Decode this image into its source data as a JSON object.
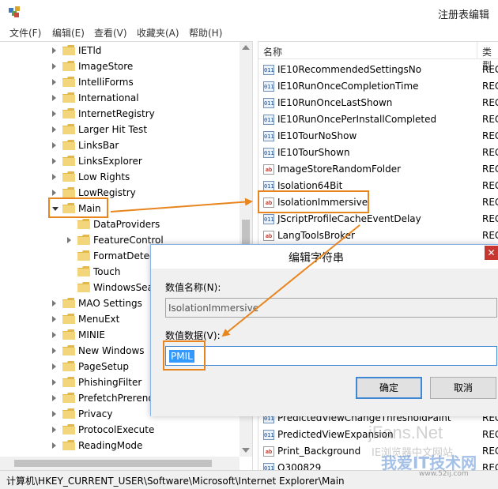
{
  "window": {
    "title": "注册表编辑"
  },
  "menu": [
    "文件(F)",
    "编辑(E)",
    "查看(V)",
    "收藏夹(A)",
    "帮助(H)"
  ],
  "tree": {
    "items": [
      {
        "label": "IETld",
        "level": 1,
        "expanded": false
      },
      {
        "label": "ImageStore",
        "level": 1,
        "expanded": false
      },
      {
        "label": "IntelliForms",
        "level": 1,
        "expanded": false
      },
      {
        "label": "International",
        "level": 1,
        "expanded": false
      },
      {
        "label": "InternetRegistry",
        "level": 1,
        "expanded": false
      },
      {
        "label": "Larger Hit Test",
        "level": 1,
        "expanded": false
      },
      {
        "label": "LinksBar",
        "level": 1,
        "expanded": false
      },
      {
        "label": "LinksExplorer",
        "level": 1,
        "expanded": false
      },
      {
        "label": "Low Rights",
        "level": 1,
        "expanded": false
      },
      {
        "label": "LowRegistry",
        "level": 1,
        "expanded": false
      },
      {
        "label": "Main",
        "level": 1,
        "expanded": true
      },
      {
        "label": "DataProviders",
        "level": 2,
        "expanded": null
      },
      {
        "label": "FeatureControl",
        "level": 2,
        "expanded": false
      },
      {
        "label": "FormatDetec",
        "level": 2,
        "expanded": null
      },
      {
        "label": "Touch",
        "level": 2,
        "expanded": null
      },
      {
        "label": "WindowsSea",
        "level": 2,
        "expanded": null
      },
      {
        "label": "MAO Settings",
        "level": 1,
        "expanded": false
      },
      {
        "label": "MenuExt",
        "level": 1,
        "expanded": false
      },
      {
        "label": "MINIE",
        "level": 1,
        "expanded": false
      },
      {
        "label": "New Windows",
        "level": 1,
        "expanded": false
      },
      {
        "label": "PageSetup",
        "level": 1,
        "expanded": false
      },
      {
        "label": "PhishingFilter",
        "level": 1,
        "expanded": false
      },
      {
        "label": "PrefetchPrerend",
        "level": 1,
        "expanded": false
      },
      {
        "label": "Privacy",
        "level": 1,
        "expanded": false
      },
      {
        "label": "ProtocolExecute",
        "level": 1,
        "expanded": false
      },
      {
        "label": "ReadingMode",
        "level": 1,
        "expanded": false
      }
    ]
  },
  "list": {
    "columns": {
      "name": "名称",
      "type": "类型"
    },
    "rows": [
      {
        "icon": "bin",
        "name": "IE10RecommendedSettingsNo",
        "type": "REG"
      },
      {
        "icon": "bin",
        "name": "IE10RunOnceCompletionTime",
        "type": "REG"
      },
      {
        "icon": "bin",
        "name": "IE10RunOnceLastShown",
        "type": "REG"
      },
      {
        "icon": "bin",
        "name": "IE10RunOncePerInstallCompleted",
        "type": "REG"
      },
      {
        "icon": "bin",
        "name": "IE10TourNoShow",
        "type": "REG"
      },
      {
        "icon": "bin",
        "name": "IE10TourShown",
        "type": "REG"
      },
      {
        "icon": "str",
        "name": "ImageStoreRandomFolder",
        "type": "REG"
      },
      {
        "icon": "bin",
        "name": "Isolation64Bit",
        "type": "REG"
      },
      {
        "icon": "str",
        "name": "IsolationImmersive",
        "type": "REG"
      },
      {
        "icon": "bin",
        "name": "JScriptProfileCacheEventDelay",
        "type": "REG"
      },
      {
        "icon": "str",
        "name": "LangToolsBroker",
        "type": "REG"
      }
    ],
    "bottom_rows": [
      {
        "icon": "bin",
        "name": "PredictedViewChangeThresholdPaint",
        "type": "REG"
      },
      {
        "icon": "bin",
        "name": "PredictedViewExpansion",
        "type": "REG"
      },
      {
        "icon": "str",
        "name": "Print_Background",
        "type": "REG"
      },
      {
        "icon": "bin",
        "name": "Q300829",
        "type": "REG"
      }
    ]
  },
  "status": {
    "path": "计算机\\HKEY_CURRENT_USER\\Software\\Microsoft\\Internet Explorer\\Main"
  },
  "dialog": {
    "title": "编辑字符串",
    "close_glyph": "✕",
    "name_label": "数值名称(N):",
    "name_value": "IsolationImmersive",
    "data_label": "数值数据(V):",
    "data_value": "PMIL",
    "ok_label": "确定",
    "cancel_label": "取消"
  },
  "icons": {
    "string_glyph": "ab",
    "binary_glyph": "011"
  },
  "watermark": {
    "line1": "jFans.Net",
    "line2": "IE浏览器中文网站",
    "line3": "我爱IT技术网",
    "line4": "www.52ij.com"
  },
  "colors": {
    "highlight": "#e8851f",
    "selection": "#3399ff",
    "close": "#c7372f",
    "folder": "#e8c45a"
  }
}
